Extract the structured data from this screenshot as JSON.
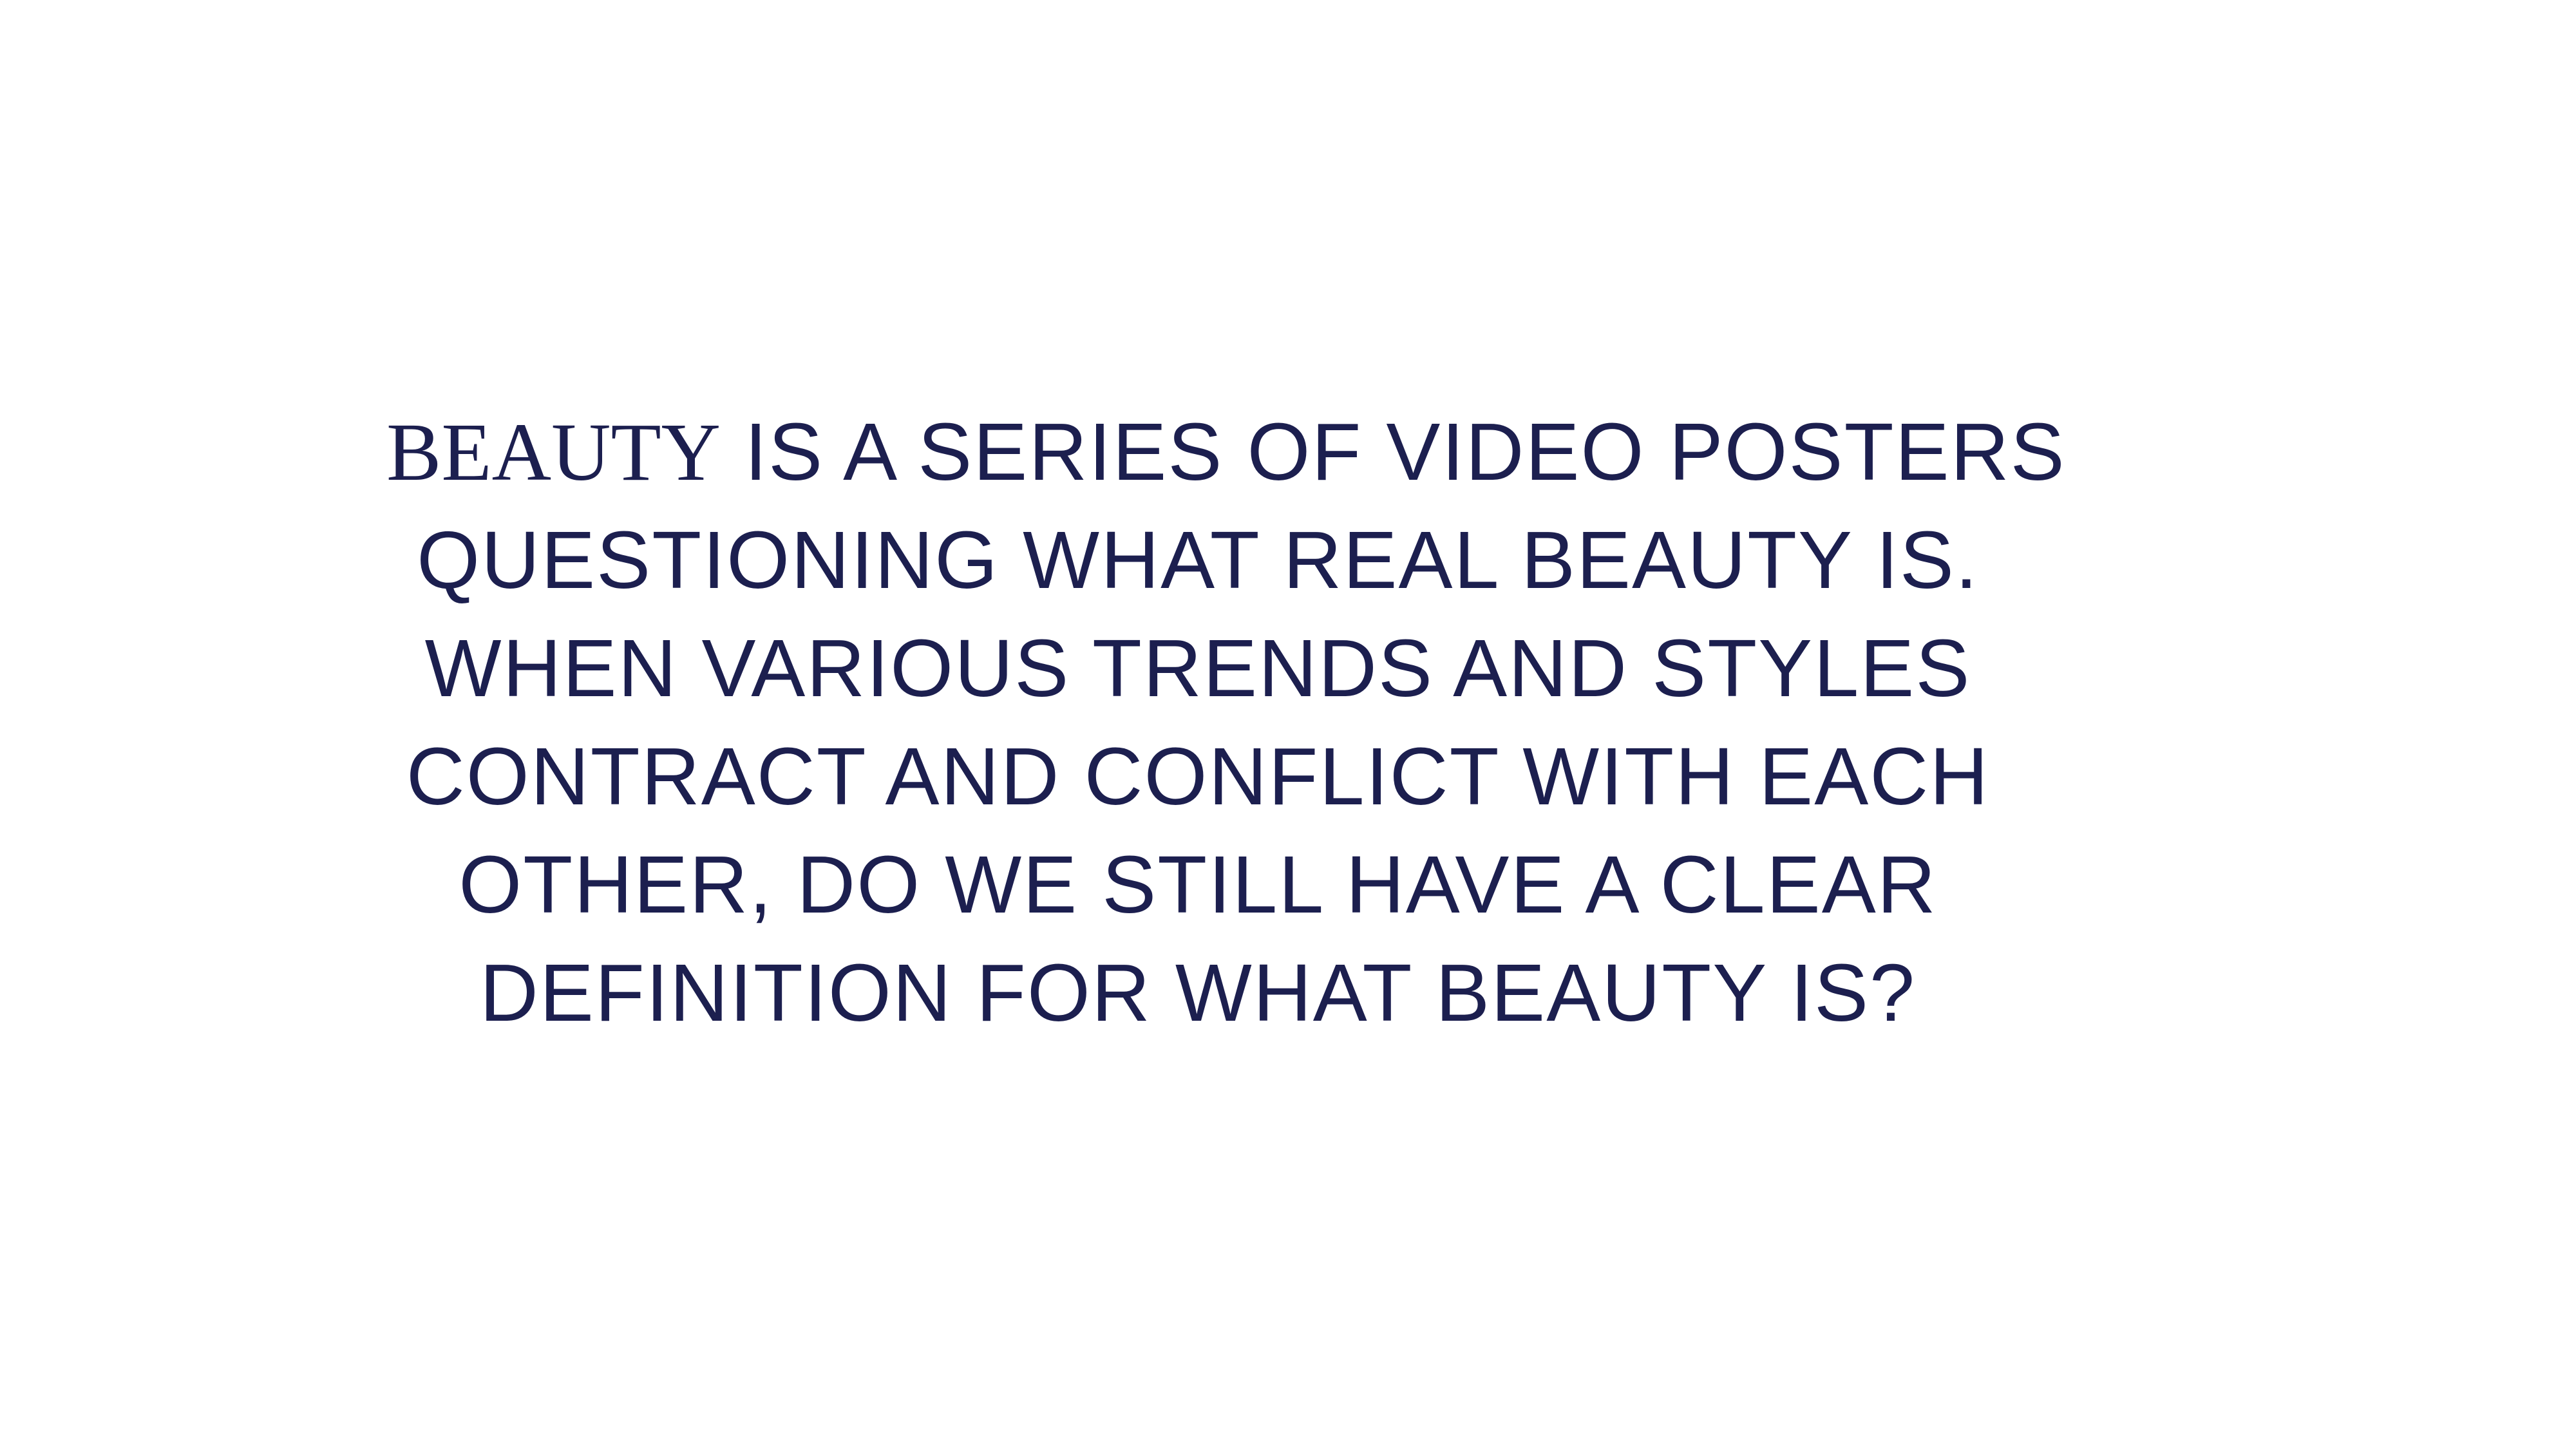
{
  "statement": {
    "brand": "BEAUTY",
    "line1_rest": " IS A SERIES OF VIDEO POSTERS",
    "line2": "QUESTIONING WHAT REAL BEAUTY IS.",
    "line3": "WHEN VARIOUS TRENDS AND STYLES",
    "line4": "CONTRACT AND CONFLICT WITH EACH",
    "line5": "OTHER, DO WE STILL HAVE A CLEAR",
    "line6": "DEFINITION FOR WHAT BEAUTY IS?"
  },
  "colors": {
    "text": "#1c1f4f",
    "background": "#ffffff"
  }
}
